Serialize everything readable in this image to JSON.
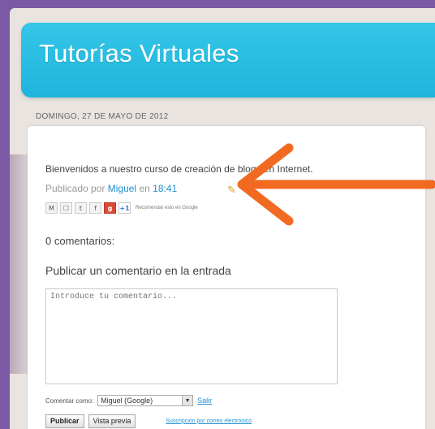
{
  "blog": {
    "title": "Tutorías Virtuales"
  },
  "post": {
    "date": "DOMINGO, 27 DE MAYO DE 2012",
    "body": "Bienvenidos a nuestro curso de creación de blogs en Internet.",
    "meta_prefix": "Publicado por",
    "author": "Miguel",
    "meta_middle": "en",
    "time": "18:41",
    "edit_icon": "pencil-icon",
    "share_buttons": [
      "M",
      "☐",
      "t",
      "f",
      "g",
      "+1"
    ],
    "share_text": "Recomendar esto en Google"
  },
  "comments": {
    "title": "0 comentarios:",
    "form_title": "Publicar un comentario en la entrada",
    "placeholder": "Introduce tu comentario...",
    "comment_as_label": "Comentar como:",
    "comment_as_value": "Miguel (Google)",
    "logout_label": "Salir",
    "publish_label": "Publicar",
    "preview_label": "Vista previa",
    "subscribe_label": "Suscripción por correo electrónico"
  },
  "colors": {
    "accent": "#1fb4dc",
    "annotation_arrow": "#f26a21",
    "link": "#1f8fd1",
    "background": "#7b5aa3"
  }
}
